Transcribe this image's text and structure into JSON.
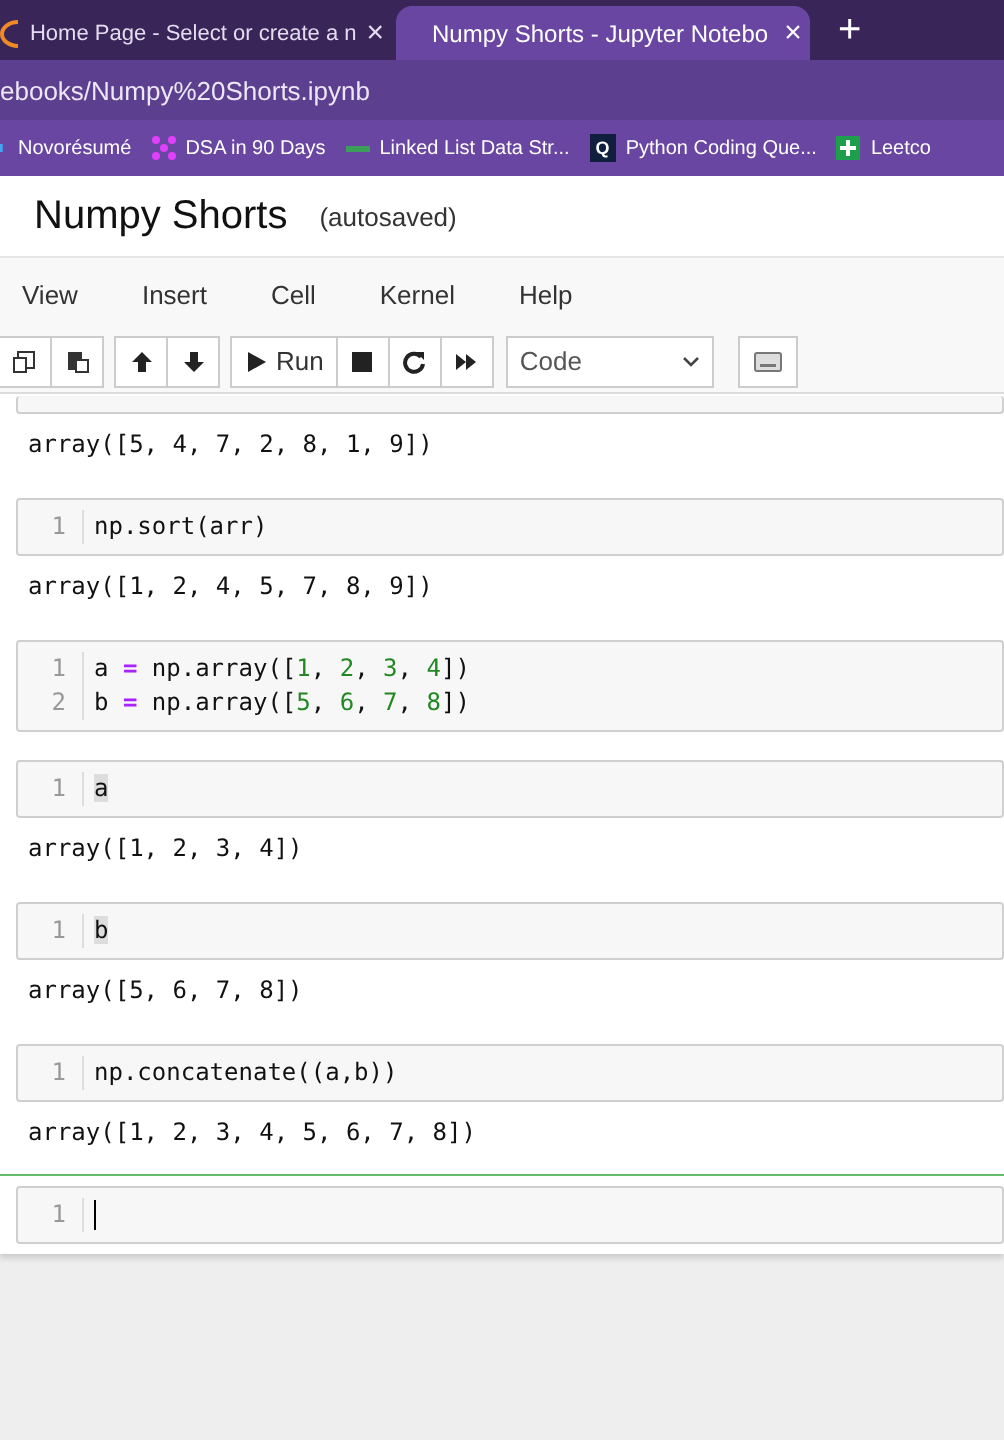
{
  "browser": {
    "tabs": [
      {
        "title": "Home Page - Select or create a n",
        "selected": false,
        "close": "×"
      },
      {
        "title": "Numpy Shorts - Jupyter Notebo",
        "selected": true,
        "close": "×"
      }
    ],
    "new_tab": "+",
    "address": "ebooks/Numpy%20Shorts.ipynb",
    "bookmarks": [
      {
        "label": "Novorésumé",
        "kind": "bar"
      },
      {
        "label": "DSA in 90 Days",
        "kind": "dots"
      },
      {
        "label": "Linked List Data Str...",
        "kind": "dash"
      },
      {
        "label": "Python Coding Que...",
        "kind": "letter",
        "badge": "Q"
      },
      {
        "label": "Leetco",
        "kind": "plus"
      }
    ]
  },
  "notebook": {
    "title": "Numpy Shorts",
    "status": "(autosaved)",
    "menu": [
      "View",
      "Insert",
      "Cell",
      "Kernel",
      "Help"
    ],
    "toolbar": {
      "run": "Run",
      "cell_type": "Code"
    },
    "cells": [
      {
        "selected": false,
        "output": "array([5, 4, 7, 2, 8, 1, 9])"
      },
      {
        "selected": false,
        "lines": [
          {
            "number": "1",
            "tokens": [
              {
                "text": "np.sort(arr)",
                "kind": "plain"
              }
            ]
          }
        ],
        "output": "array([1, 2, 4, 5, 7, 8, 9])"
      },
      {
        "selected": false,
        "lines": [
          {
            "number": "1",
            "tokens": [
              {
                "text": "a ",
                "kind": "plain"
              },
              {
                "text": "=",
                "kind": "operator"
              },
              {
                "text": " np.array([",
                "kind": "plain"
              },
              {
                "text": "1",
                "kind": "number"
              },
              {
                "text": ", ",
                "kind": "plain"
              },
              {
                "text": "2",
                "kind": "number"
              },
              {
                "text": ", ",
                "kind": "plain"
              },
              {
                "text": "3",
                "kind": "number"
              },
              {
                "text": ", ",
                "kind": "plain"
              },
              {
                "text": "4",
                "kind": "number"
              },
              {
                "text": "])",
                "kind": "plain"
              }
            ]
          },
          {
            "number": "2",
            "tokens": [
              {
                "text": "b ",
                "kind": "plain"
              },
              {
                "text": "=",
                "kind": "operator"
              },
              {
                "text": " np.array([",
                "kind": "plain"
              },
              {
                "text": "5",
                "kind": "number"
              },
              {
                "text": ", ",
                "kind": "plain"
              },
              {
                "text": "6",
                "kind": "number"
              },
              {
                "text": ", ",
                "kind": "plain"
              },
              {
                "text": "7",
                "kind": "number"
              },
              {
                "text": ", ",
                "kind": "plain"
              },
              {
                "text": "8",
                "kind": "number"
              },
              {
                "text": "])",
                "kind": "plain"
              }
            ]
          }
        ]
      },
      {
        "selected": false,
        "lines": [
          {
            "number": "1",
            "tokens": [
              {
                "text": "a",
                "kind": "highlight"
              }
            ]
          }
        ],
        "output": "array([1, 2, 3, 4])"
      },
      {
        "selected": false,
        "lines": [
          {
            "number": "1",
            "tokens": [
              {
                "text": "b",
                "kind": "highlight"
              }
            ]
          }
        ],
        "output": "array([5, 6, 7, 8])"
      },
      {
        "selected": false,
        "lines": [
          {
            "number": "1",
            "tokens": [
              {
                "text": "np.concatenate((a,b))",
                "kind": "plain"
              }
            ]
          }
        ],
        "output": "array([1, 2, 3, 4, 5, 6, 7, 8])"
      },
      {
        "selected": true,
        "lines": [
          {
            "number": "1"
          }
        ]
      }
    ]
  }
}
